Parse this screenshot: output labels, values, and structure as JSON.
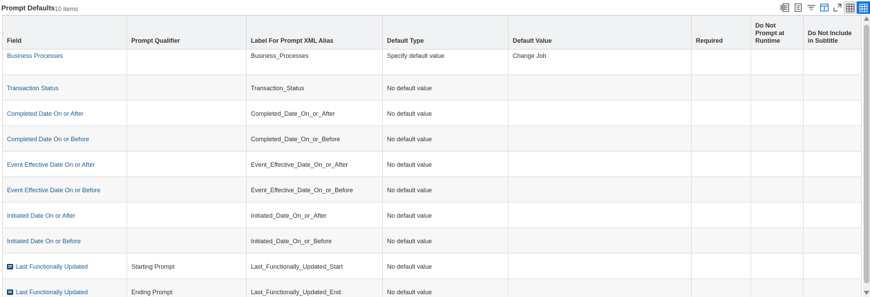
{
  "header": {
    "title": "Prompt Defaults",
    "count": "10 items",
    "toolbar_icons": [
      "export-excel-icon",
      "print-pdf-icon",
      "filter-icon",
      "column-chooser-icon",
      "fullscreen-icon",
      "table-view-icon",
      "grid-view-icon"
    ]
  },
  "table": {
    "columns": [
      "Field",
      "Prompt Qualifier",
      "Label For Prompt XML Alias",
      "Default Type",
      "Default Value",
      "Required",
      "Do Not Prompt at Runtime",
      "Do Not Include in Subtitle"
    ],
    "rows": [
      {
        "field": "Business Processes",
        "qualifier": "",
        "alias": "Business_Processes",
        "type": "Specify default value",
        "value": "Change Job",
        "required": "",
        "no_prompt": "",
        "no_subtitle": ""
      },
      {
        "field": "Transaction Status",
        "qualifier": "",
        "alias": "Transaction_Status",
        "type": "No default value",
        "value": "",
        "required": "",
        "no_prompt": "",
        "no_subtitle": ""
      },
      {
        "field": "Completed Date On or After",
        "qualifier": "",
        "alias": "Completed_Date_On_or_After",
        "type": "No default value",
        "value": "",
        "required": "",
        "no_prompt": "",
        "no_subtitle": ""
      },
      {
        "field": "Completed Date On or Before",
        "qualifier": "",
        "alias": "Completed_Date_On_or_Before",
        "type": "No default value",
        "value": "",
        "required": "",
        "no_prompt": "",
        "no_subtitle": ""
      },
      {
        "field": "Event Effective Date On or After",
        "qualifier": "",
        "alias": "Event_Effective_Date_On_or_After",
        "type": "No default value",
        "value": "",
        "required": "",
        "no_prompt": "",
        "no_subtitle": ""
      },
      {
        "field": "Event Effective Date On or Before",
        "qualifier": "",
        "alias": "Event_Effective_Date_On_or_Before",
        "type": "No default value",
        "value": "",
        "required": "",
        "no_prompt": "",
        "no_subtitle": ""
      },
      {
        "field": "Initiated Date On or After",
        "qualifier": "",
        "alias": "Initiated_Date_On_or_After",
        "type": "No default value",
        "value": "",
        "required": "",
        "no_prompt": "",
        "no_subtitle": ""
      },
      {
        "field": "Initiated Date On or Before",
        "qualifier": "",
        "alias": "Initiated_Date_On_or_Before",
        "type": "No default value",
        "value": "",
        "required": "",
        "no_prompt": "",
        "no_subtitle": ""
      },
      {
        "field": "Last Functionally Updated",
        "field_icon": "related-actions-icon",
        "qualifier": "Starting Prompt",
        "alias": "Last_Functionally_Updated_Start",
        "type": "No default value",
        "value": "",
        "required": "",
        "no_prompt": "",
        "no_subtitle": ""
      },
      {
        "field": "Last Functionally Updated",
        "field_icon": "related-actions-icon",
        "qualifier": "Ending Prompt",
        "alias": "Last_Functionally_Updated_End",
        "type": "No default value",
        "value": "",
        "required": "",
        "no_prompt": "",
        "no_subtitle": ""
      }
    ]
  }
}
